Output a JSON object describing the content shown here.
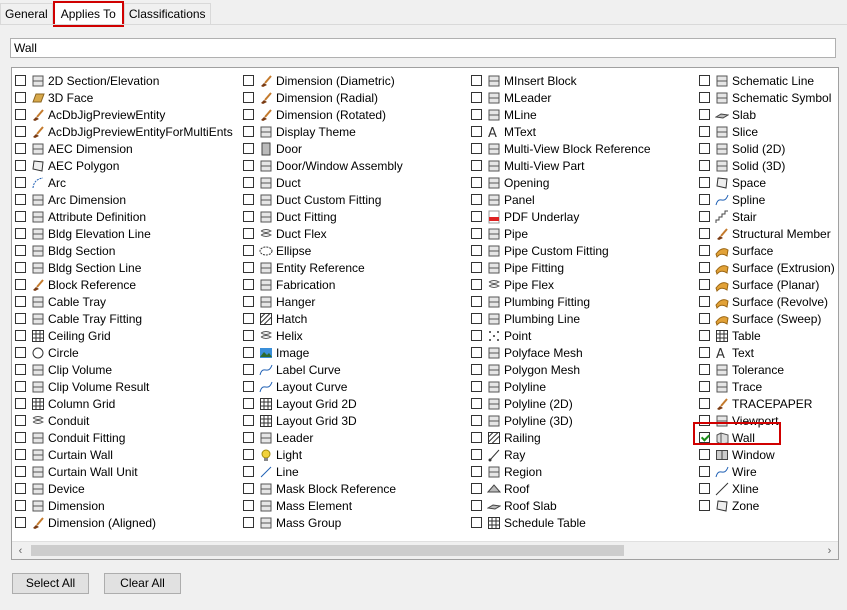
{
  "tabs": [
    {
      "label": "General"
    },
    {
      "label": "Applies To"
    },
    {
      "label": "Classifications"
    }
  ],
  "filter": {
    "value": "Wall"
  },
  "buttons": {
    "select_all": "Select All",
    "clear_all": "Clear All"
  },
  "columns": [
    [
      {
        "label": "2D Section/Elevation",
        "icon": "section-icon",
        "checked": false
      },
      {
        "label": "3D Face",
        "icon": "face-icon",
        "checked": false
      },
      {
        "label": "AcDbJigPreviewEntity",
        "icon": "brush-icon",
        "checked": false
      },
      {
        "label": "AcDbJigPreviewEntityForMultiEnts",
        "icon": "brush-icon",
        "checked": false
      },
      {
        "label": "AEC Dimension",
        "icon": "dimension-icon",
        "checked": false
      },
      {
        "label": "AEC Polygon",
        "icon": "polygon-icon",
        "checked": false
      },
      {
        "label": "Arc",
        "icon": "arc-icon",
        "checked": false
      },
      {
        "label": "Arc Dimension",
        "icon": "arc-dimension-icon",
        "checked": false
      },
      {
        "label": "Attribute Definition",
        "icon": "tag-icon",
        "checked": false
      },
      {
        "label": "Bldg Elevation Line",
        "icon": "elevation-line-icon",
        "checked": false
      },
      {
        "label": "Bldg Section",
        "icon": "section-icon",
        "checked": false
      },
      {
        "label": "Bldg Section Line",
        "icon": "section-line-icon",
        "checked": false
      },
      {
        "label": "Block Reference",
        "icon": "brush-icon",
        "checked": false
      },
      {
        "label": "Cable Tray",
        "icon": "cable-tray-icon",
        "checked": false
      },
      {
        "label": "Cable Tray Fitting",
        "icon": "cable-fitting-icon",
        "checked": false
      },
      {
        "label": "Ceiling Grid",
        "icon": "grid-icon",
        "checked": false
      },
      {
        "label": "Circle",
        "icon": "circle-icon",
        "checked": false
      },
      {
        "label": "Clip Volume",
        "icon": "clip-volume-icon",
        "checked": false
      },
      {
        "label": "Clip Volume Result",
        "icon": "clip-volume-icon",
        "checked": false
      },
      {
        "label": "Column Grid",
        "icon": "column-grid-icon",
        "checked": false
      },
      {
        "label": "Conduit",
        "icon": "conduit-icon",
        "checked": false
      },
      {
        "label": "Conduit Fitting",
        "icon": "conduit-fitting-icon",
        "checked": false
      },
      {
        "label": "Curtain Wall",
        "icon": "curtain-wall-icon",
        "checked": false
      },
      {
        "label": "Curtain Wall Unit",
        "icon": "curtain-wall-icon",
        "checked": false
      },
      {
        "label": "Device",
        "icon": "device-icon",
        "checked": false
      },
      {
        "label": "Dimension",
        "icon": "dimension-icon",
        "checked": false
      },
      {
        "label": "Dimension (Aligned)",
        "icon": "brush-icon",
        "checked": false
      }
    ],
    [
      {
        "label": "Dimension (Diametric)",
        "icon": "brush-icon",
        "checked": false
      },
      {
        "label": "Dimension (Radial)",
        "icon": "brush-icon",
        "checked": false
      },
      {
        "label": "Dimension (Rotated)",
        "icon": "brush-icon",
        "checked": false
      },
      {
        "label": "Display Theme",
        "icon": "display-theme-icon",
        "checked": false
      },
      {
        "label": "Door",
        "icon": "door-icon",
        "checked": false
      },
      {
        "label": "Door/Window Assembly",
        "icon": "door-window-icon",
        "checked": false
      },
      {
        "label": "Duct",
        "icon": "duct-icon",
        "checked": false
      },
      {
        "label": "Duct Custom Fitting",
        "icon": "duct-fitting-icon",
        "checked": false
      },
      {
        "label": "Duct Fitting",
        "icon": "duct-fitting-icon",
        "checked": false
      },
      {
        "label": "Duct Flex",
        "icon": "duct-flex-icon",
        "checked": false
      },
      {
        "label": "Ellipse",
        "icon": "ellipse-icon",
        "checked": false
      },
      {
        "label": "Entity Reference",
        "icon": "entity-reference-icon",
        "checked": false
      },
      {
        "label": "Fabrication",
        "icon": "fabrication-icon",
        "checked": false
      },
      {
        "label": "Hanger",
        "icon": "hanger-icon",
        "checked": false
      },
      {
        "label": "Hatch",
        "icon": "hatch-icon",
        "checked": false
      },
      {
        "label": "Helix",
        "icon": "helix-icon",
        "checked": false
      },
      {
        "label": "Image",
        "icon": "image-icon",
        "checked": false
      },
      {
        "label": "Label Curve",
        "icon": "label-curve-icon",
        "checked": false
      },
      {
        "label": "Layout Curve",
        "icon": "layout-curve-icon",
        "checked": false
      },
      {
        "label": "Layout Grid 2D",
        "icon": "grid-icon",
        "checked": false
      },
      {
        "label": "Layout Grid 3D",
        "icon": "grid-icon",
        "checked": false
      },
      {
        "label": "Leader",
        "icon": "leader-icon",
        "checked": false
      },
      {
        "label": "Light",
        "icon": "light-icon",
        "checked": false
      },
      {
        "label": "Line",
        "icon": "line-icon",
        "checked": false
      },
      {
        "label": "Mask Block Reference",
        "icon": "mask-block-icon",
        "checked": false
      },
      {
        "label": "Mass Element",
        "icon": "mass-element-icon",
        "checked": false
      },
      {
        "label": "Mass Group",
        "icon": "mass-group-icon",
        "checked": false
      }
    ],
    [
      {
        "label": "MInsert Block",
        "icon": "minsert-icon",
        "checked": false
      },
      {
        "label": "MLeader",
        "icon": "mleader-icon",
        "checked": false
      },
      {
        "label": "MLine",
        "icon": "mline-icon",
        "checked": false
      },
      {
        "label": "MText",
        "icon": "text-icon",
        "checked": false
      },
      {
        "label": "Multi-View Block Reference",
        "icon": "multi-view-block-icon",
        "checked": false
      },
      {
        "label": "Multi-View Part",
        "icon": "multi-view-part-icon",
        "checked": false
      },
      {
        "label": "Opening",
        "icon": "opening-icon",
        "checked": false
      },
      {
        "label": "Panel",
        "icon": "panel-icon",
        "checked": false
      },
      {
        "label": "PDF Underlay",
        "icon": "pdf-icon",
        "checked": false
      },
      {
        "label": "Pipe",
        "icon": "pipe-icon",
        "checked": false
      },
      {
        "label": "Pipe Custom Fitting",
        "icon": "pipe-fitting-icon",
        "checked": false
      },
      {
        "label": "Pipe Fitting",
        "icon": "pipe-fitting-icon",
        "checked": false
      },
      {
        "label": "Pipe Flex",
        "icon": "pipe-flex-icon",
        "checked": false
      },
      {
        "label": "Plumbing Fitting",
        "icon": "plumbing-fitting-icon",
        "checked": false
      },
      {
        "label": "Plumbing Line",
        "icon": "plumbing-line-icon",
        "checked": false
      },
      {
        "label": "Point",
        "icon": "point-icon",
        "checked": false
      },
      {
        "label": "Polyface Mesh",
        "icon": "polyface-mesh-icon",
        "checked": false
      },
      {
        "label": "Polygon Mesh",
        "icon": "polygon-mesh-icon",
        "checked": false
      },
      {
        "label": "Polyline",
        "icon": "polyline-icon",
        "checked": false
      },
      {
        "label": "Polyline (2D)",
        "icon": "polyline-2d-icon",
        "checked": false
      },
      {
        "label": "Polyline (3D)",
        "icon": "polyline-3d-icon",
        "checked": false
      },
      {
        "label": "Railing",
        "icon": "railing-icon",
        "checked": false
      },
      {
        "label": "Ray",
        "icon": "ray-icon",
        "checked": false
      },
      {
        "label": "Region",
        "icon": "region-icon",
        "checked": false
      },
      {
        "label": "Roof",
        "icon": "roof-icon",
        "checked": false
      },
      {
        "label": "Roof Slab",
        "icon": "roof-slab-icon",
        "checked": false
      },
      {
        "label": "Schedule Table",
        "icon": "schedule-table-icon",
        "checked": false
      }
    ],
    [
      {
        "label": "Schematic Line",
        "icon": "schematic-line-icon",
        "checked": false
      },
      {
        "label": "Schematic Symbol",
        "icon": "schematic-symbol-icon",
        "checked": false
      },
      {
        "label": "Slab",
        "icon": "slab-icon",
        "checked": false
      },
      {
        "label": "Slice",
        "icon": "slice-icon",
        "checked": false
      },
      {
        "label": "Solid (2D)",
        "icon": "solid-2d-icon",
        "checked": false
      },
      {
        "label": "Solid (3D)",
        "icon": "solid-3d-icon",
        "checked": false
      },
      {
        "label": "Space",
        "icon": "space-icon",
        "checked": false
      },
      {
        "label": "Spline",
        "icon": "spline-icon",
        "checked": false
      },
      {
        "label": "Stair",
        "icon": "stair-icon",
        "checked": false
      },
      {
        "label": "Structural Member",
        "icon": "brush-icon",
        "checked": false
      },
      {
        "label": "Surface",
        "icon": "surface-icon",
        "checked": false
      },
      {
        "label": "Surface (Extrusion)",
        "icon": "surface-icon",
        "checked": false
      },
      {
        "label": "Surface (Planar)",
        "icon": "surface-icon",
        "checked": false
      },
      {
        "label": "Surface (Revolve)",
        "icon": "surface-icon",
        "checked": false
      },
      {
        "label": "Surface (Sweep)",
        "icon": "surface-icon",
        "checked": false
      },
      {
        "label": "Table",
        "icon": "table-icon",
        "checked": false
      },
      {
        "label": "Text",
        "icon": "text-icon",
        "checked": false
      },
      {
        "label": "Tolerance",
        "icon": "tolerance-icon",
        "checked": false
      },
      {
        "label": "Trace",
        "icon": "trace-icon",
        "checked": false
      },
      {
        "label": "TRACEPAPER",
        "icon": "brush-icon",
        "checked": false
      },
      {
        "label": "Viewport",
        "icon": "viewport-icon",
        "checked": false
      },
      {
        "label": "Wall",
        "icon": "wall-icon",
        "checked": true
      },
      {
        "label": "Window",
        "icon": "window-icon",
        "checked": false
      },
      {
        "label": "Wire",
        "icon": "wire-icon",
        "checked": false
      },
      {
        "label": "Xline",
        "icon": "xline-icon",
        "checked": false
      },
      {
        "label": "Zone",
        "icon": "zone-icon",
        "checked": false
      }
    ]
  ],
  "scroll_arrows": {
    "left": "‹",
    "right": "›"
  }
}
